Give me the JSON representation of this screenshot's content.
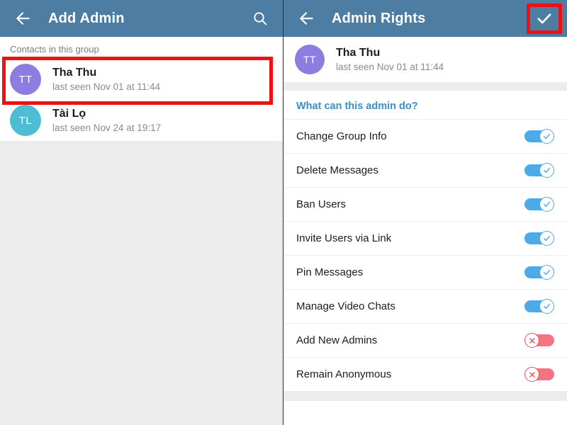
{
  "left_panel": {
    "appbar": {
      "back_icon": "arrow-left-icon",
      "title": "Add Admin",
      "search_icon": "search-icon"
    },
    "section_label": "Contacts in this group",
    "contacts": [
      {
        "initials": "TT",
        "name": "Tha Thu",
        "status": "last seen Nov 01 at 11:44",
        "avatar_color": "#8b7ee0",
        "highlighted": true
      },
      {
        "initials": "TL",
        "name": "Tài Lọ",
        "status": "last seen Nov 24 at 19:17",
        "avatar_color": "#4dbdd4",
        "highlighted": false
      }
    ]
  },
  "right_panel": {
    "appbar": {
      "back_icon": "arrow-left-icon",
      "title": "Admin Rights",
      "confirm_icon": "check-icon"
    },
    "profile": {
      "initials": "TT",
      "name": "Tha Thu",
      "status": "last seen Nov 01 at 11:44",
      "avatar_color": "#8b7ee0"
    },
    "settings_title": "What can this admin do?",
    "settings": [
      {
        "label": "Change Group Info",
        "state": "on"
      },
      {
        "label": "Delete Messages",
        "state": "on"
      },
      {
        "label": "Ban Users",
        "state": "on"
      },
      {
        "label": "Invite Users via Link",
        "state": "on"
      },
      {
        "label": "Pin Messages",
        "state": "on"
      },
      {
        "label": "Manage Video Chats",
        "state": "on"
      },
      {
        "label": "Add New Admins",
        "state": "off"
      },
      {
        "label": "Remain Anonymous",
        "state": "off"
      }
    ]
  },
  "annotations": {
    "contact_highlight": "red-rectangle-highlight",
    "confirm_highlight": "red-rectangle-highlight",
    "color": "#ee1111"
  },
  "colors": {
    "appbar": "#4e7da4",
    "accent_blue": "#3a8fc4",
    "toggle_on": "#4aabe8",
    "toggle_off": "#f47481",
    "page_background": "#ececec"
  }
}
